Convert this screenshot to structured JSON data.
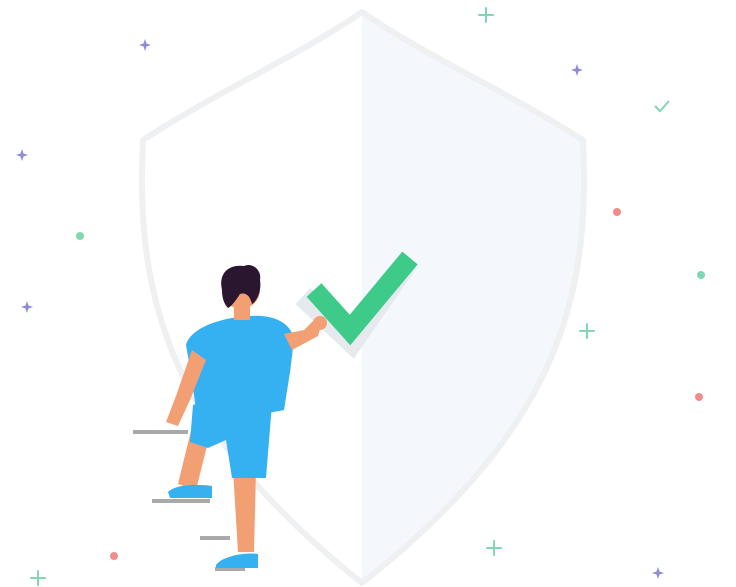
{
  "illustration": {
    "subject": "security-shield-check",
    "colors": {
      "background": "#ffffff",
      "shield_left": "#ffffff",
      "shield_right": "#f4f8fc",
      "shield_outline": "#eef0f2",
      "check_mark": "#3ecb8a",
      "check_shadow": "#e6eaee",
      "shirt": "#35b1f1",
      "shorts": "#35b1f1",
      "skin": "#f2a073",
      "hair": "#2b1630",
      "shoes": "#35b1f1",
      "steps": "#a7a9ab",
      "sparkle_purple": "#8e8bd8",
      "sparkle_green": "#7fd7b3",
      "dot_red": "#f28b8b",
      "dot_green": "#7fd7b3"
    },
    "icons": [
      "shield-icon",
      "check-icon",
      "person-figure",
      "step-icon",
      "sparkle-icon",
      "dot-icon"
    ]
  }
}
